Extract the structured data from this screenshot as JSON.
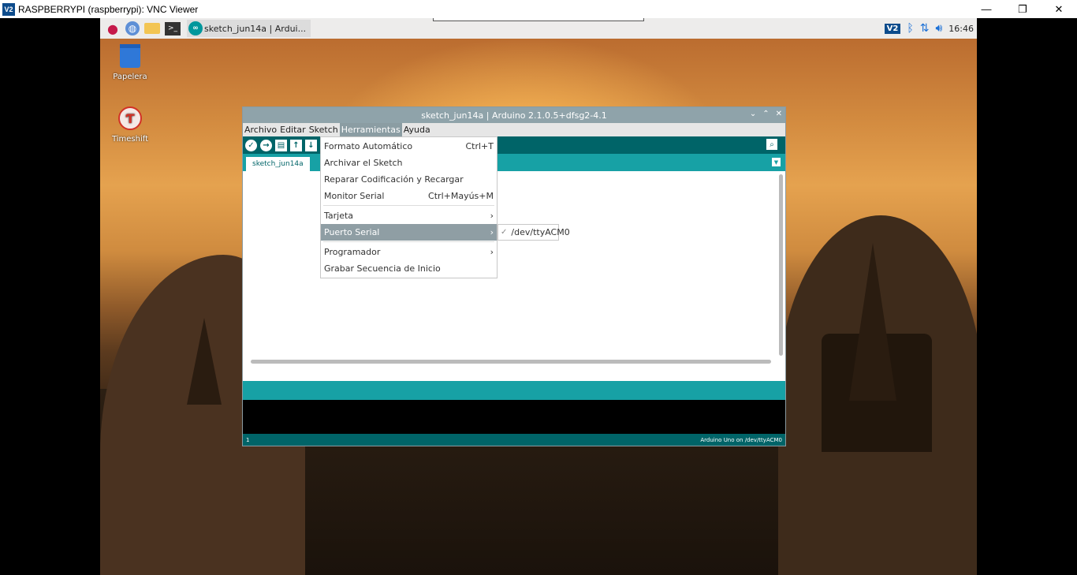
{
  "vnc": {
    "title": "RASPBERRYPI (raspberrypi): VNC Viewer",
    "logo": "V2",
    "minimize": "—",
    "restore": "❐",
    "close": "✕"
  },
  "panel": {
    "task_label": "sketch_jun14a | Ardui...",
    "clock": "16:46",
    "vnc_badge": "V2"
  },
  "desktop": {
    "trash_label": "Papelera",
    "timeshift_label": "Timeshift"
  },
  "ide": {
    "title": "sketch_jun14a | Arduino 2.1.0.5+dfsg2-4.1",
    "menus": [
      "Archivo",
      "Editar",
      "Sketch",
      "Herramientas",
      "Ayuda"
    ],
    "tab": "sketch_jun14a",
    "status_line": "1",
    "status_board": "Arduino Uno on /dev/ttyACM0"
  },
  "tools_menu": {
    "items": [
      {
        "label": "Formato Automático",
        "shortcut": "Ctrl+T"
      },
      {
        "label": "Archivar el Sketch",
        "shortcut": ""
      },
      {
        "label": "Reparar Codificación y Recargar",
        "shortcut": ""
      },
      {
        "label": "Monitor Serial",
        "shortcut": "Ctrl+Mayús+M"
      },
      {
        "label": "Tarjeta",
        "shortcut": "›"
      },
      {
        "label": "Puerto Serial",
        "shortcut": "›"
      },
      {
        "label": "Programador",
        "shortcut": "›"
      },
      {
        "label": "Grabar Secuencia de Inicio",
        "shortcut": ""
      }
    ],
    "port_submenu": {
      "check": "✓",
      "label": "/dev/ttyACM0"
    }
  },
  "colors": {
    "arduino_teal_dark": "#006468",
    "arduino_teal": "#17a1a5",
    "menu_highlight": "#8f9ea4"
  }
}
